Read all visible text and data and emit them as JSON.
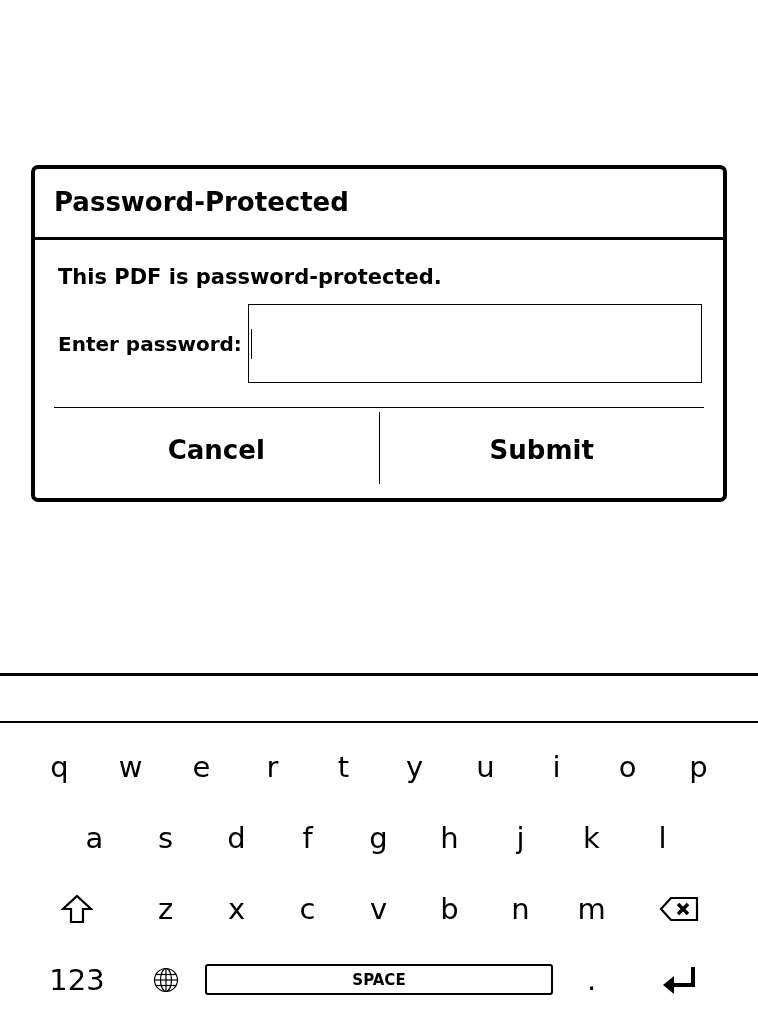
{
  "dialog": {
    "title": "Password-Protected",
    "message": "This PDF is password-protected.",
    "field": {
      "label": "Enter password:",
      "focused": true
    },
    "buttons": [
      "Cancel",
      "Submit"
    ]
  },
  "keyboard": {
    "letter_rows": [
      {
        "keys": [
          {
            "kind": "char",
            "label": "q"
          },
          {
            "kind": "char",
            "label": "w"
          },
          {
            "kind": "char",
            "label": "e"
          },
          {
            "kind": "char",
            "label": "r"
          },
          {
            "kind": "char",
            "label": "t"
          },
          {
            "kind": "char",
            "label": "y"
          },
          {
            "kind": "char",
            "label": "u"
          },
          {
            "kind": "char",
            "label": "i"
          },
          {
            "kind": "char",
            "label": "o"
          },
          {
            "kind": "char",
            "label": "p"
          }
        ]
      },
      {
        "keys": [
          {
            "kind": "char",
            "label": "a"
          },
          {
            "kind": "char",
            "label": "s"
          },
          {
            "kind": "char",
            "label": "d"
          },
          {
            "kind": "char",
            "label": "f"
          },
          {
            "kind": "char",
            "label": "g"
          },
          {
            "kind": "char",
            "label": "h"
          },
          {
            "kind": "char",
            "label": "j"
          },
          {
            "kind": "char",
            "label": "k"
          },
          {
            "kind": "char",
            "label": "l"
          }
        ]
      },
      {
        "keys": [
          {
            "kind": "shift"
          },
          {
            "kind": "char",
            "label": "z"
          },
          {
            "kind": "char",
            "label": "x"
          },
          {
            "kind": "char",
            "label": "c"
          },
          {
            "kind": "char",
            "label": "v"
          },
          {
            "kind": "char",
            "label": "b"
          },
          {
            "kind": "char",
            "label": "n"
          },
          {
            "kind": "char",
            "label": "m"
          },
          {
            "kind": "backspace"
          }
        ]
      }
    ],
    "bottom_row": {
      "keys": [
        {
          "kind": "mode",
          "label": "123"
        },
        {
          "kind": "globe"
        },
        {
          "kind": "space",
          "label": "SPACE"
        },
        {
          "kind": "char",
          "label": "."
        },
        {
          "kind": "enter"
        }
      ]
    }
  }
}
